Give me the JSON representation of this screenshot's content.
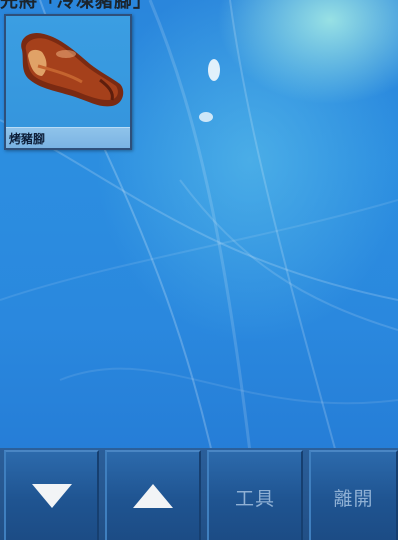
{
  "top_caption": "先將「冷凍豬腳」",
  "items": [
    {
      "label": "烤豬腳",
      "icon": "roasted-pork-knuckle-icon"
    }
  ],
  "toolbar": {
    "scroll_down_icon": "triangle-down-icon",
    "scroll_up_icon": "triangle-up-icon",
    "tools_label": "工具",
    "exit_label": "離開"
  },
  "colors": {
    "background": "#2a88de",
    "toolbar": "#1f5491",
    "disabled_text": "#8fb0d4"
  }
}
